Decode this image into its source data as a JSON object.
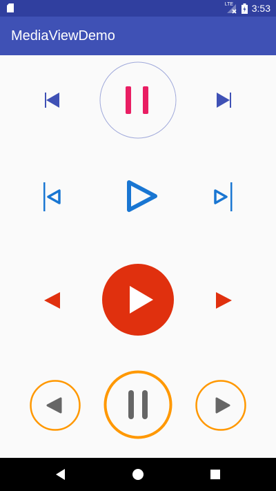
{
  "status_bar": {
    "time": "3:53",
    "network_label": "LTE",
    "icons": [
      "sd-card-icon",
      "lte-signal-icon",
      "battery-icon"
    ]
  },
  "app_bar": {
    "title": "MediaViewDemo"
  },
  "colors": {
    "status_bar": "#303f9f",
    "app_bar": "#3f51b5",
    "row1_arrows": "#3f51b5",
    "row1_pause": "#e91e63",
    "row1_ring": "#9fa8da",
    "row2_blue": "#1976d2",
    "row3_red": "#e0300e",
    "row4_ring": "#ff9800",
    "row4_icon": "#666666",
    "background": "#fafafa",
    "nav_bar": "#000000"
  },
  "players": [
    {
      "style": "flat-with-ring",
      "state": "playing",
      "controls": [
        "previous",
        "pause",
        "next"
      ]
    },
    {
      "style": "outline",
      "state": "paused",
      "controls": [
        "previous",
        "play",
        "next"
      ]
    },
    {
      "style": "filled-circle",
      "state": "paused",
      "controls": [
        "previous",
        "play",
        "next"
      ]
    },
    {
      "style": "ringed-buttons",
      "state": "playing",
      "controls": [
        "previous",
        "pause",
        "next"
      ]
    }
  ],
  "nav": {
    "icons": [
      "back-icon",
      "home-icon",
      "recents-icon"
    ]
  }
}
